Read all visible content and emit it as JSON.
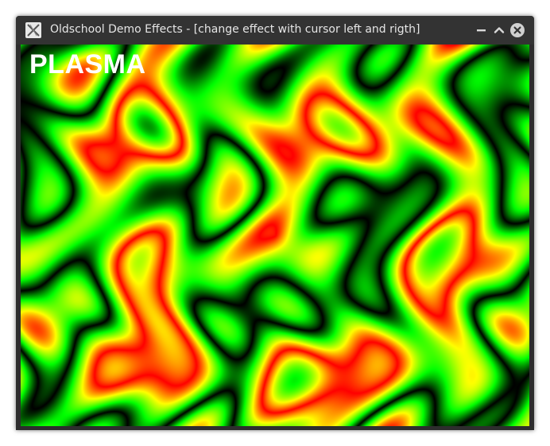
{
  "window": {
    "title": "Oldschool Demo Effects - [change effect with cursor left and rigth]"
  },
  "demo": {
    "effect_name": "PLASMA",
    "palette": [
      "#000000",
      "#00ff00",
      "#ffff00",
      "#ff0000"
    ]
  },
  "colors": {
    "titlebar_bg": "#333333",
    "title_text": "#e6e6e6",
    "frame": "#2d2d2d"
  }
}
